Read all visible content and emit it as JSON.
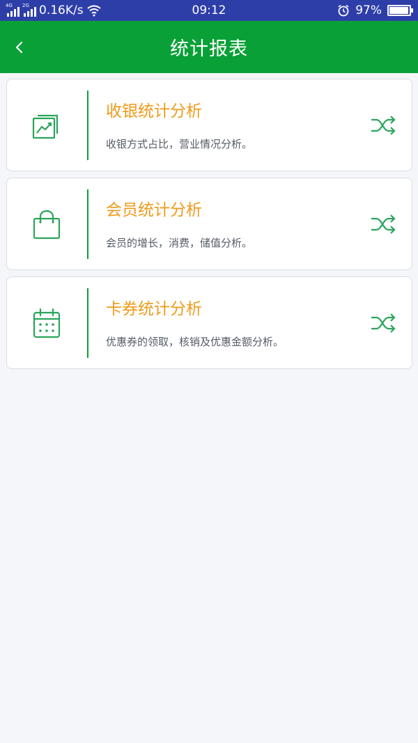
{
  "status_bar": {
    "network_1": "4G",
    "network_2": "2G",
    "speed": "0.16K/s",
    "time": "09:12",
    "battery": "97%",
    "battery_level": 0.97,
    "icons": [
      "signal-icon",
      "wifi-icon",
      "alarm-icon",
      "battery-icon"
    ]
  },
  "app_bar": {
    "title": "统计报表",
    "back_icon": "chevron-left-icon"
  },
  "colors": {
    "status_bar": "#2e3ea8",
    "brand_green": "#0aa038",
    "title_orange": "#f09a1a",
    "background": "#f4f6fa"
  },
  "cards": [
    {
      "title": "收银统计分析",
      "desc": "收银方式占比，营业情况分析。",
      "icon": "chart-icon",
      "action_icon": "shuffle-icon"
    },
    {
      "title": "会员统计分析",
      "desc": "会员的增长，消费，储值分析。",
      "icon": "shopping-bag-icon",
      "action_icon": "shuffle-icon"
    },
    {
      "title": "卡券统计分析",
      "desc": "优惠券的领取，核销及优惠金额分析。",
      "icon": "calendar-icon",
      "action_icon": "shuffle-icon"
    }
  ]
}
